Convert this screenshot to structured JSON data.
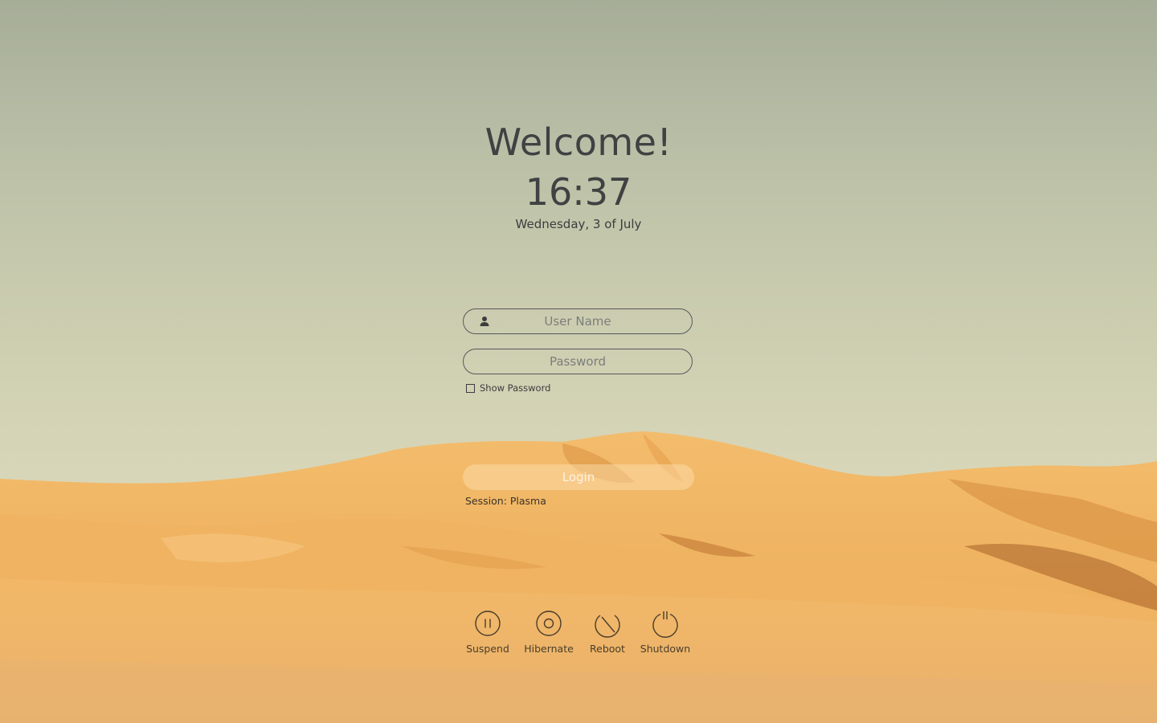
{
  "greeting": "Welcome!",
  "clock": {
    "time": "16:37",
    "date": "Wednesday, 3 of July"
  },
  "login_form": {
    "username_placeholder": "User Name",
    "password_placeholder": "Password",
    "show_password_label": "Show Password",
    "show_password_checked": false,
    "login_label": "Login",
    "session_label": "Session: Plasma"
  },
  "power_actions": [
    {
      "label": "Suspend",
      "icon": "suspend-icon"
    },
    {
      "label": "Hibernate",
      "icon": "hibernate-icon"
    },
    {
      "label": "Reboot",
      "icon": "reboot-icon"
    },
    {
      "label": "Shutdown",
      "icon": "shutdown-icon"
    }
  ],
  "colors": {
    "text": "#3f4142",
    "sky_top": "#a6ad98",
    "sky_bottom": "#d8d6b8",
    "sand": "#efb466"
  },
  "background": {
    "icon": "desert-dunes-wallpaper"
  }
}
